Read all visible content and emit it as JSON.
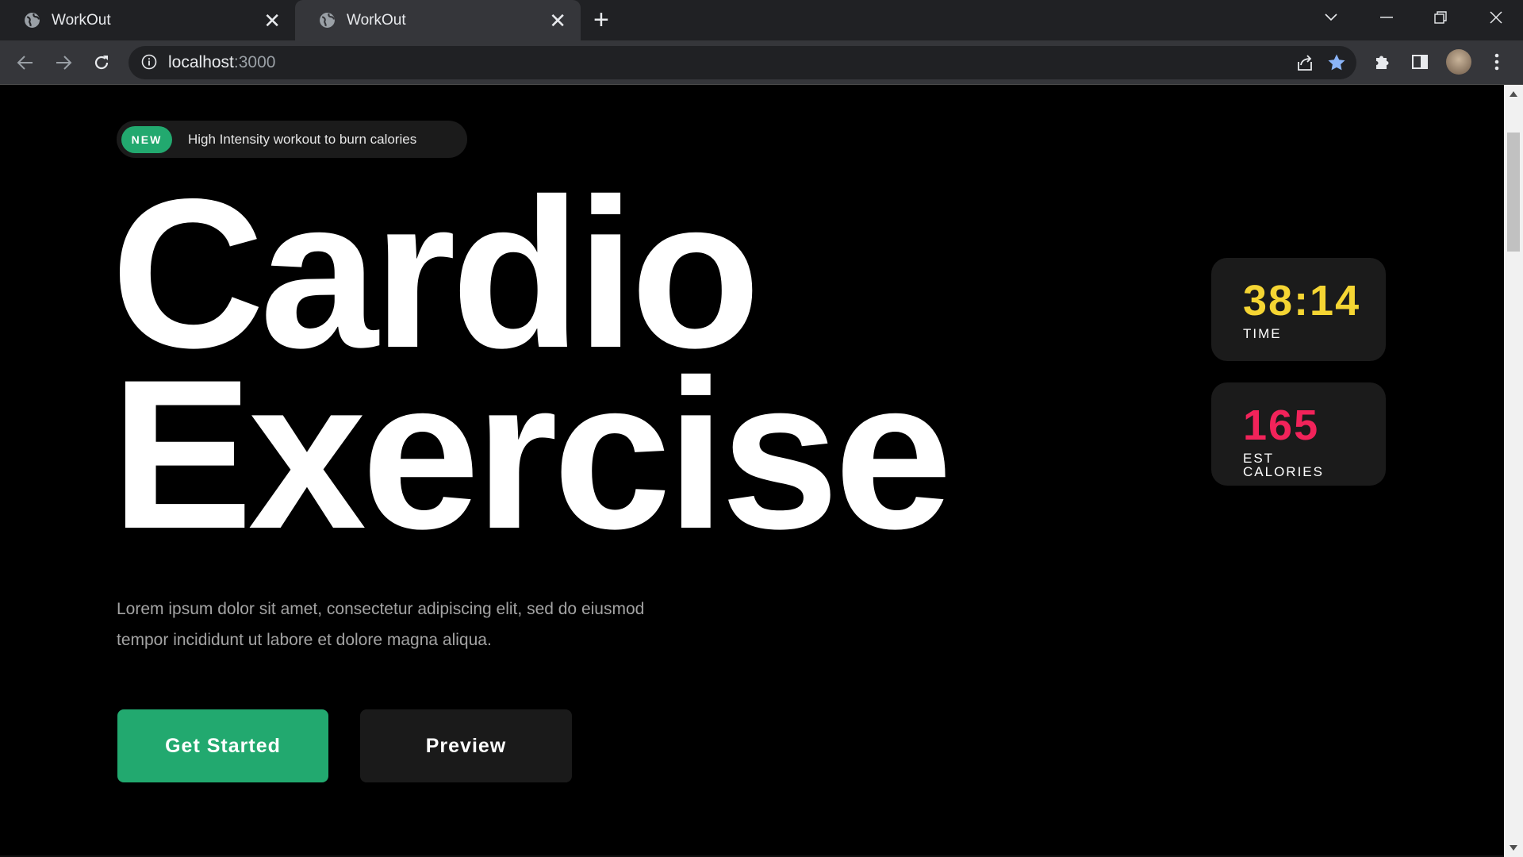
{
  "browser": {
    "tabs": [
      {
        "title": "WorkOut",
        "active": false
      },
      {
        "title": "WorkOut",
        "active": true
      }
    ],
    "url_host": "localhost",
    "url_port": ":3000"
  },
  "hero": {
    "badge": "NEW",
    "tagline": "High Intensity workout to burn calories",
    "headline_line1": "Cardio",
    "headline_line2": "Exercise",
    "description_line1": "Lorem ipsum dolor sit amet, consectetur adipiscing elit, sed do eiusmod",
    "description_line2": "tempor incididunt ut labore et dolore magna aliqua.",
    "primary_button": "Get Started",
    "secondary_button": "Preview"
  },
  "stats": {
    "time": {
      "value": "38:14",
      "label": "TIME",
      "color": "#f5d533"
    },
    "calories": {
      "value": "165",
      "label": "EST CALORIES",
      "color": "#f1235a"
    }
  },
  "colors": {
    "accent_green": "#22a96f",
    "background": "#000000",
    "card": "#1b1b1b"
  },
  "icons": [
    "globe-icon",
    "close-icon",
    "plus-icon",
    "chevron-down-icon",
    "minimize-icon",
    "restore-icon",
    "back-arrow-icon",
    "forward-arrow-icon",
    "reload-icon",
    "info-icon",
    "share-icon",
    "star-icon",
    "puzzle-icon",
    "side-panel-icon",
    "avatar",
    "more-vert-icon"
  ]
}
